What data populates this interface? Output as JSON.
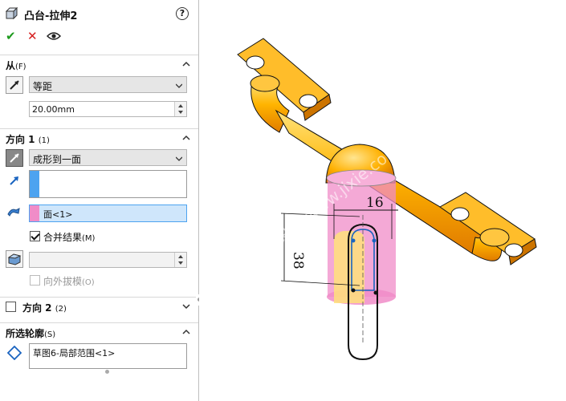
{
  "feature": {
    "title": "凸台-拉伸2",
    "help_icon": "question-icon"
  },
  "actions": {
    "ok_icon": "checkmark-icon",
    "cancel_icon": "close-icon",
    "preview_icon": "eye-icon",
    "ok_glyph": "✔",
    "cancel_glyph": "✕"
  },
  "from_section": {
    "label": "从",
    "shortcut": "(F)",
    "start_condition": "等距",
    "offset_value": "20.00mm"
  },
  "direction1_section": {
    "label": "方向 1",
    "shortcut": "(1)",
    "end_condition": "成形到一面",
    "face_selection": "面<1>",
    "merge_result_label": "合并结果",
    "merge_result_shortcut": "(M)",
    "merge_result_checked": true,
    "draft_outward_label": "向外拔模",
    "draft_outward_shortcut": "(O)",
    "draft_outward_checked": false,
    "swatch_blue": "#4da3f0",
    "swatch_pink": "#f08cc8"
  },
  "direction2_section": {
    "label": "方向 2",
    "shortcut": "(2)",
    "checked": false
  },
  "selected_contours_section": {
    "label": "所选轮廓",
    "shortcut": "(S)",
    "items": [
      "草图6-局部范围<1>"
    ]
  },
  "viewport": {
    "dimension_width": "16",
    "dimension_height": "38",
    "watermark": "机械设计 www.jixie.com"
  }
}
